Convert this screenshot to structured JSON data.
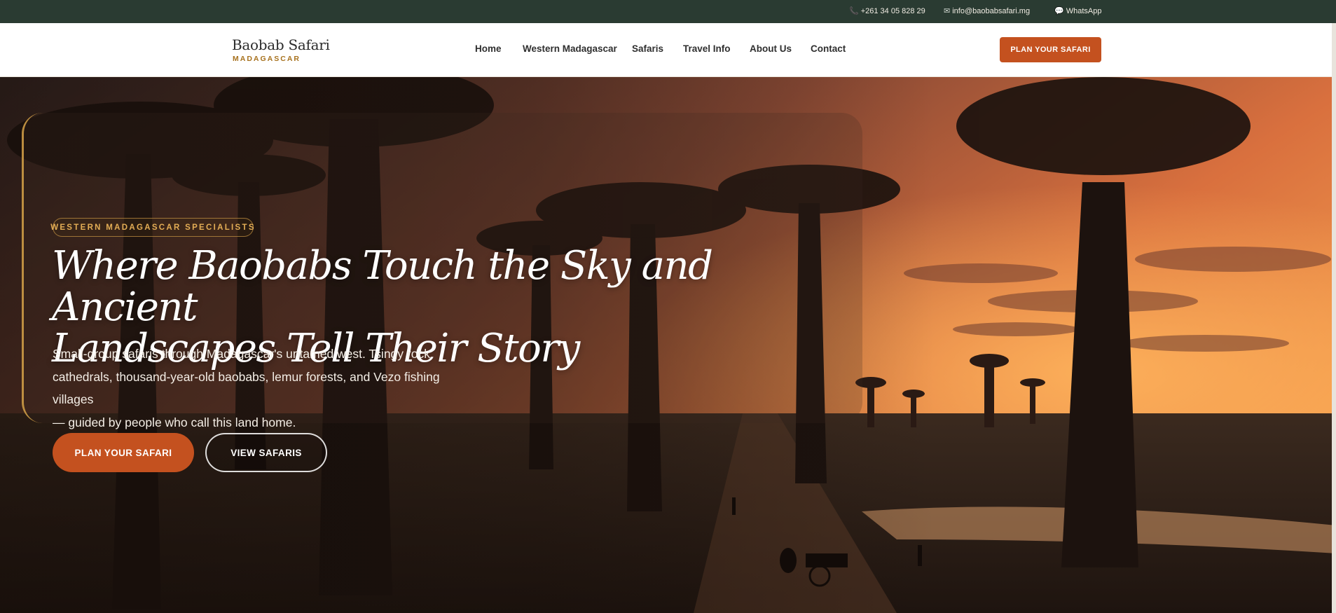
{
  "topbar": {
    "phone": "+261 34 05 828 29",
    "email": "info@baobabsafari.mg",
    "whatsapp": "WhatsApp",
    "phone_icon": "phone-icon",
    "email_icon": "envelope-icon",
    "whatsapp_icon": "chat-bubble-icon"
  },
  "header": {
    "logo_title": "Baobab Safari",
    "logo_sub": "MADAGASCAR",
    "nav": [
      "Home",
      "Western Madagascar",
      "Safaris",
      "Travel Info",
      "About Us",
      "Contact"
    ],
    "cta": "PLAN YOUR SAFARI"
  },
  "hero": {
    "badge": "WESTERN MADAGASCAR SPECIALISTS",
    "headline_line1": "Where Baobabs Touch the Sky and Ancient",
    "headline_line2": "Landscapes Tell Their Story",
    "sub_line1": "Small-group safaris through Madagascar's untamed west. Tsingy rock",
    "sub_line2": "cathedrals, thousand-year-old baobabs, lemur forests, and Vezo fishing villages",
    "sub_line3": "— guided by people who call this land home.",
    "primary_button": "PLAN YOUR SAFARI",
    "secondary_button": "VIEW SAFARIS"
  },
  "colors": {
    "topbar_bg": "#2a3b32",
    "accent_orange": "#c4511f",
    "accent_gold": "#a7711d"
  }
}
